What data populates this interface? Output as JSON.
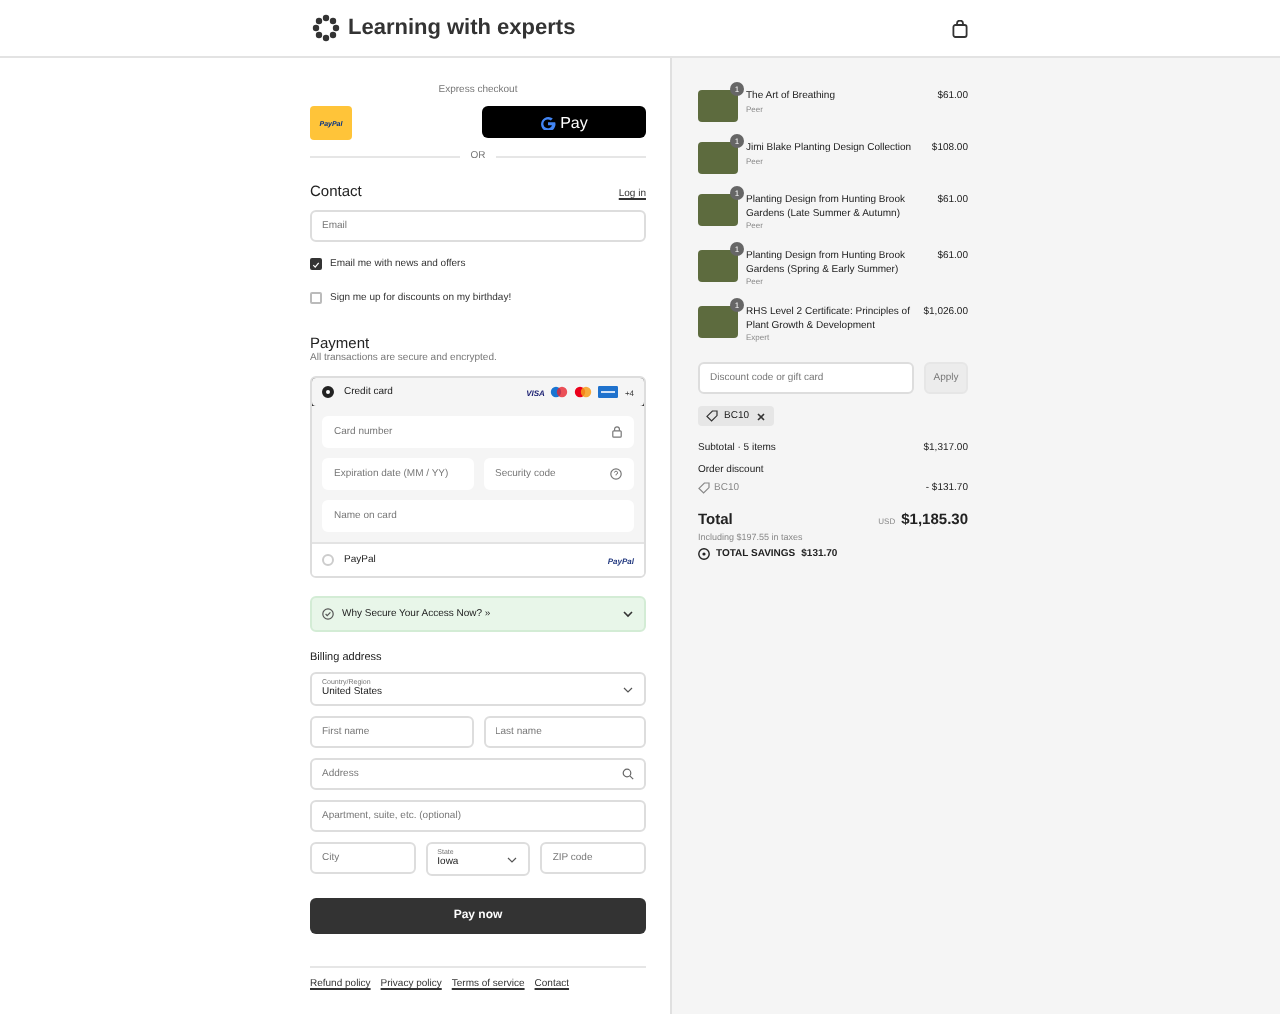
{
  "header": {
    "brand": "Learning with experts"
  },
  "express": {
    "label": "Express checkout",
    "paypal": "PayPal",
    "gpay": "Pay",
    "divider": "OR"
  },
  "contact": {
    "title": "Contact",
    "login": "Log in",
    "email": {
      "placeholder": "Email"
    },
    "options": [
      {
        "label": "Email me with news and offers",
        "checked": true
      },
      {
        "label": "Sign me up for discounts on my birthday!",
        "checked": false
      }
    ]
  },
  "payment": {
    "title": "Payment",
    "subtitle": "All transactions are secure and encrypted.",
    "methods": [
      {
        "kind": "card",
        "label": "Credit card",
        "selected": true,
        "badges": [
          "VISA",
          "+4"
        ],
        "fields": [
          {
            "placeholder": "Card number"
          },
          {
            "placeholder": "Expiration date (MM / YY)"
          },
          {
            "placeholder": "Security code"
          },
          {
            "placeholder": "Name on card"
          }
        ]
      },
      {
        "kind": "paypal",
        "label": "PayPal",
        "selected": false,
        "badge": "PayPal"
      }
    ]
  },
  "notice": {
    "label": "Why Secure Your Access Now? »",
    "expanded": false
  },
  "billing": {
    "title": "Billing address",
    "country": {
      "label": "Country/Region",
      "value": "United States"
    },
    "first_name": {
      "placeholder": "First name"
    },
    "last_name": {
      "placeholder": "Last name"
    },
    "address": {
      "placeholder": "Address"
    },
    "apartment": {
      "placeholder": "Apartment, suite, etc. (optional)"
    },
    "city": {
      "placeholder": "City"
    },
    "state": {
      "label": "State",
      "value": "Iowa"
    },
    "zip": {
      "placeholder": "ZIP code"
    }
  },
  "pay_button": "Pay now",
  "footer_links": [
    "Refund policy",
    "Privacy policy",
    "Terms of service",
    "Contact"
  ],
  "cart": {
    "items": [
      {
        "title": "The Art of Breathing",
        "subtitle": "Peer",
        "price": "$61.00",
        "quantity": "1"
      },
      {
        "title": "Jimi Blake Planting Design Collection",
        "subtitle": "Peer",
        "price": "$108.00",
        "quantity": "1"
      },
      {
        "title": "Planting Design from Hunting Brook Gardens (Late Summer & Autumn)",
        "subtitle": "Peer",
        "price": "$61.00",
        "quantity": "1"
      },
      {
        "title": "Planting Design from Hunting Brook Gardens (Spring & Early Summer)",
        "subtitle": "Peer",
        "price": "$61.00",
        "quantity": "1"
      },
      {
        "title": "RHS Level 2 Certificate: Principles of Plant Growth & Development",
        "subtitle": "Expert",
        "price": "$1,026.00",
        "quantity": "1"
      }
    ],
    "discount": {
      "placeholder": "Discount code or gift card",
      "button": "Apply"
    },
    "applied_code": "BC10",
    "subtotal": {
      "label": "Subtotal · 5 items",
      "value": "$1,317.00"
    },
    "order_discount": {
      "label": "Order discount",
      "code": "BC10",
      "value": "- $131.70"
    },
    "total": {
      "label": "Total",
      "currency": "USD",
      "value": "$1,185.30",
      "taxes": "Including $197.55 in taxes"
    },
    "savings": {
      "label": "TOTAL SAVINGS",
      "value": "$131.70"
    }
  }
}
